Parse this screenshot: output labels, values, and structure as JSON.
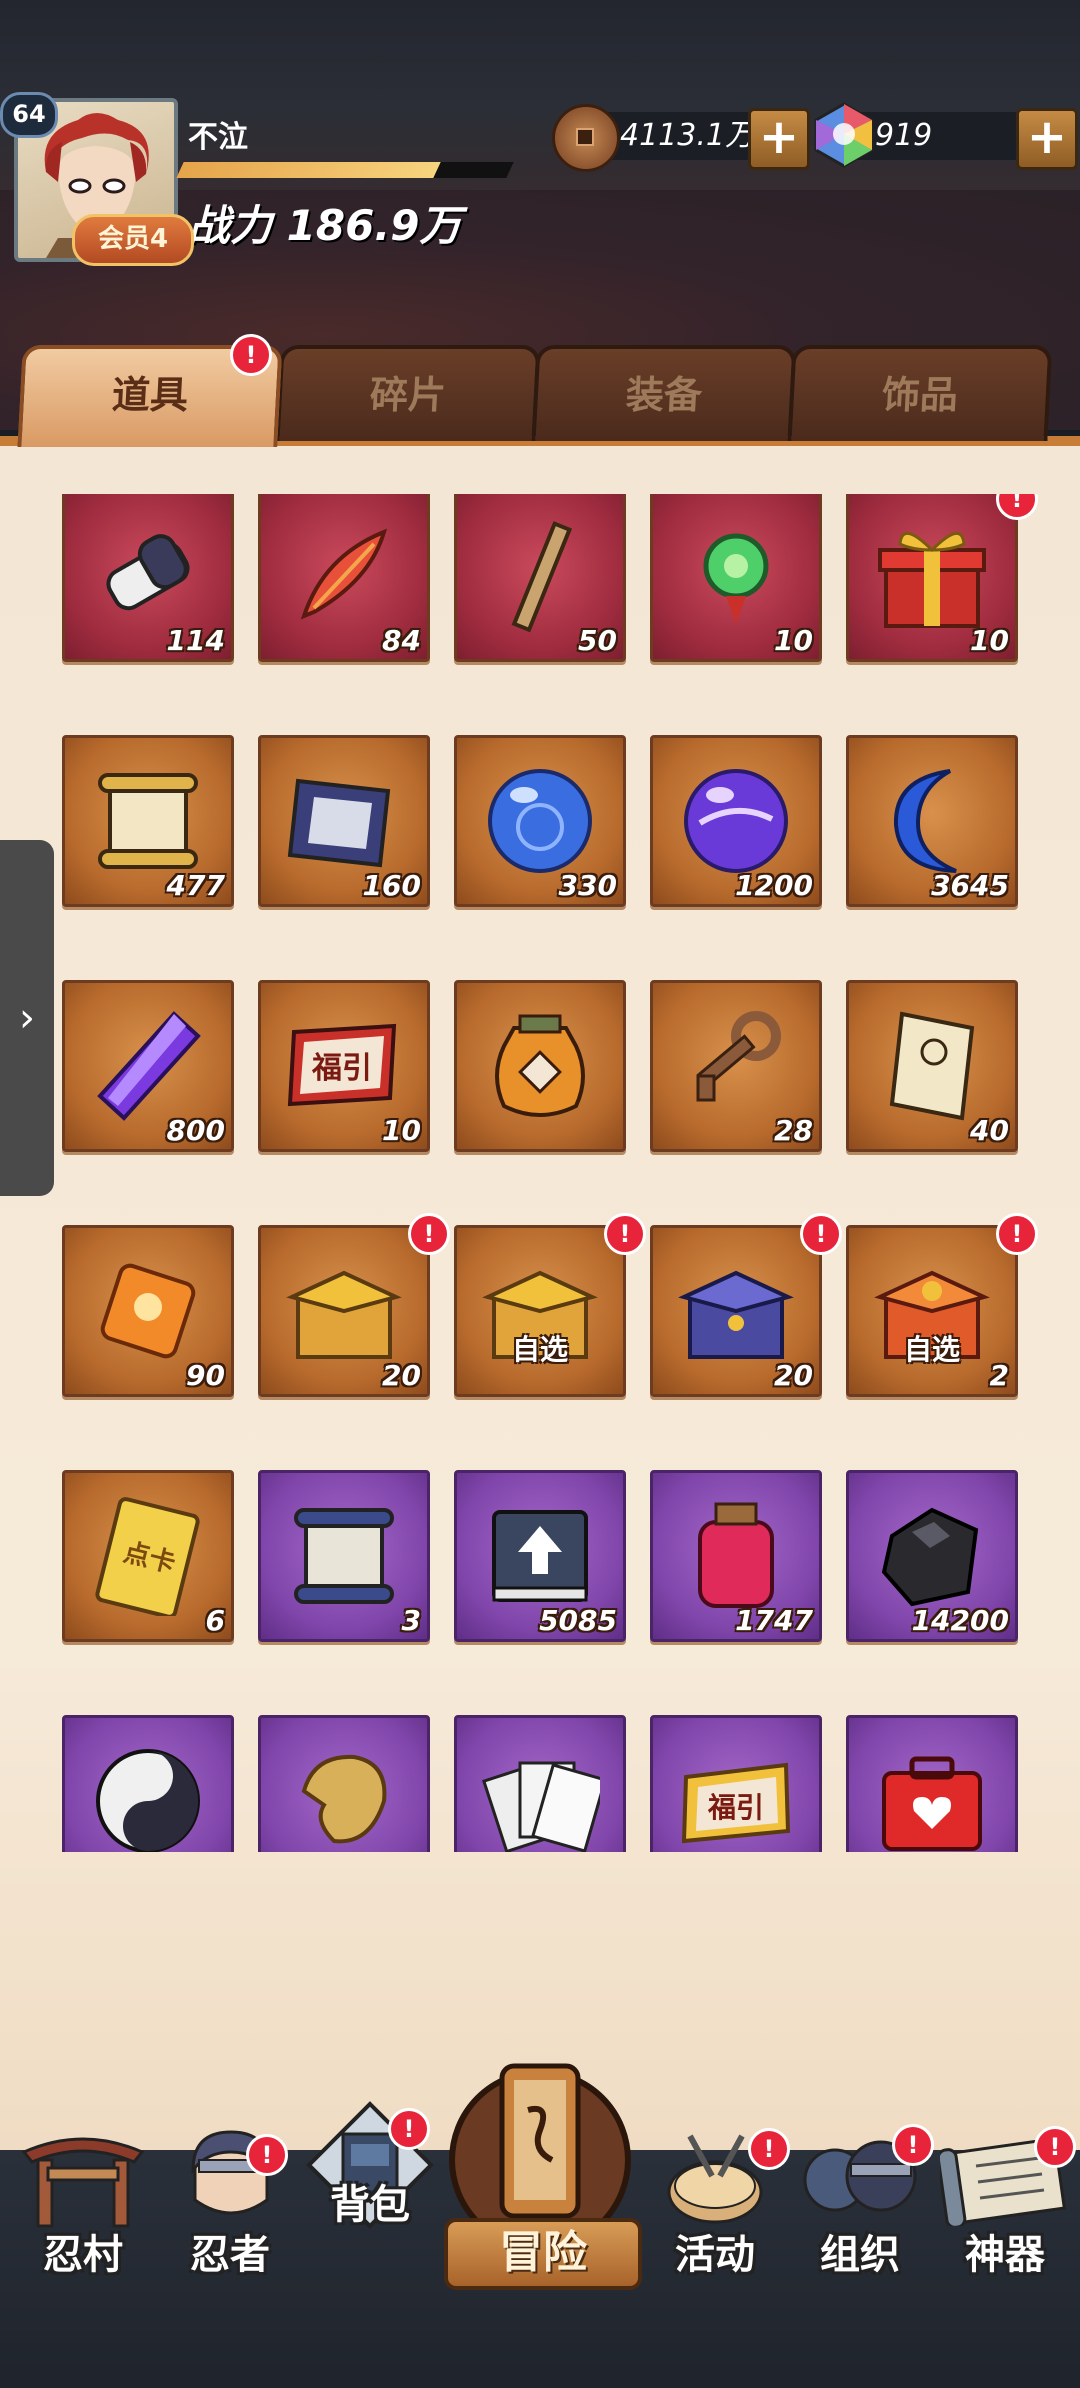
{
  "player": {
    "level": "64",
    "name": "不泣",
    "vip": "会员4",
    "power": "战力 186.9万",
    "xp_fraction": 0.78
  },
  "currency": {
    "coins": "4113.1万",
    "gems": "919",
    "plus": "+"
  },
  "tabs": [
    {
      "label": "道具",
      "active": true,
      "alert": true
    },
    {
      "label": "碎片",
      "active": false,
      "alert": false
    },
    {
      "label": "装备",
      "active": false,
      "alert": false
    },
    {
      "label": "饰品",
      "active": false,
      "alert": false
    }
  ],
  "alert_mark": "!",
  "items": [
    {
      "name": "scroll-bundle-icon",
      "qty": "114",
      "bg": "red"
    },
    {
      "name": "red-feather-icon",
      "qty": "84",
      "bg": "red"
    },
    {
      "name": "wooden-stick-icon",
      "qty": "50",
      "bg": "red"
    },
    {
      "name": "green-jade-pendant-icon",
      "qty": "10",
      "bg": "red"
    },
    {
      "name": "gold-gift-box-icon",
      "qty": "10",
      "bg": "red",
      "alert": true
    },
    {
      "name": "parchment-scroll-icon",
      "qty": "477",
      "bg": "orange"
    },
    {
      "name": "cloth-banner-icon",
      "qty": "160",
      "bg": "orange"
    },
    {
      "name": "blue-orb-icon",
      "qty": "330",
      "bg": "orange"
    },
    {
      "name": "purple-orb-icon",
      "qty": "1200",
      "bg": "orange"
    },
    {
      "name": "blue-crescent-moon-icon",
      "qty": "3645",
      "bg": "orange"
    },
    {
      "name": "purple-crystal-icon",
      "qty": "800",
      "bg": "orange"
    },
    {
      "name": "fortune-ticket-icon",
      "qty": "10",
      "bg": "orange",
      "text": "福引"
    },
    {
      "name": "clay-jar-icon",
      "qty": "",
      "bg": "orange"
    },
    {
      "name": "bronze-key-icon",
      "qty": "28",
      "bg": "orange"
    },
    {
      "name": "paper-talisman-icon",
      "qty": "40",
      "bg": "orange"
    },
    {
      "name": "orange-gem-icon",
      "qty": "90",
      "bg": "orange"
    },
    {
      "name": "gold-chest-icon",
      "qty": "20",
      "bg": "orange",
      "alert": true
    },
    {
      "name": "gold-select-chest-icon",
      "qty": "",
      "bg": "orange",
      "alert": true,
      "pick": "自选"
    },
    {
      "name": "blue-chest-icon",
      "qty": "20",
      "bg": "orange",
      "alert": true
    },
    {
      "name": "red-select-chest-icon",
      "qty": "2",
      "bg": "orange",
      "alert": true,
      "pick": "自选"
    },
    {
      "name": "point-card-icon",
      "qty": "6",
      "bg": "orange",
      "text": "点卡"
    },
    {
      "name": "blue-scroll-icon",
      "qty": "3",
      "bg": "purple"
    },
    {
      "name": "upgrade-book-icon",
      "qty": "5085",
      "bg": "purple"
    },
    {
      "name": "red-potion-jar-icon",
      "qty": "1747",
      "bg": "purple"
    },
    {
      "name": "black-ore-icon",
      "qty": "14200",
      "bg": "purple"
    },
    {
      "name": "yin-yang-icon",
      "qty": "",
      "bg": "purple"
    },
    {
      "name": "gold-fragment-icon",
      "qty": "",
      "bg": "purple"
    },
    {
      "name": "paper-cards-icon",
      "qty": "",
      "bg": "purple"
    },
    {
      "name": "fortune-paper-icon",
      "qty": "",
      "bg": "purple",
      "text": "福引"
    },
    {
      "name": "red-medkit-icon",
      "qty": "",
      "bg": "purple"
    }
  ],
  "nav": [
    {
      "label": "忍村",
      "alert": false
    },
    {
      "label": "忍者",
      "alert": true
    },
    {
      "label": "背包",
      "alert": true
    },
    {
      "label": "冒险",
      "alert": false
    },
    {
      "label": "活动",
      "alert": true
    },
    {
      "label": "组织",
      "alert": true
    },
    {
      "label": "神器",
      "alert": true
    }
  ],
  "colors": {
    "accent": "#c77c37",
    "alert": "#e8243a",
    "panel": "#f4e6d4"
  }
}
